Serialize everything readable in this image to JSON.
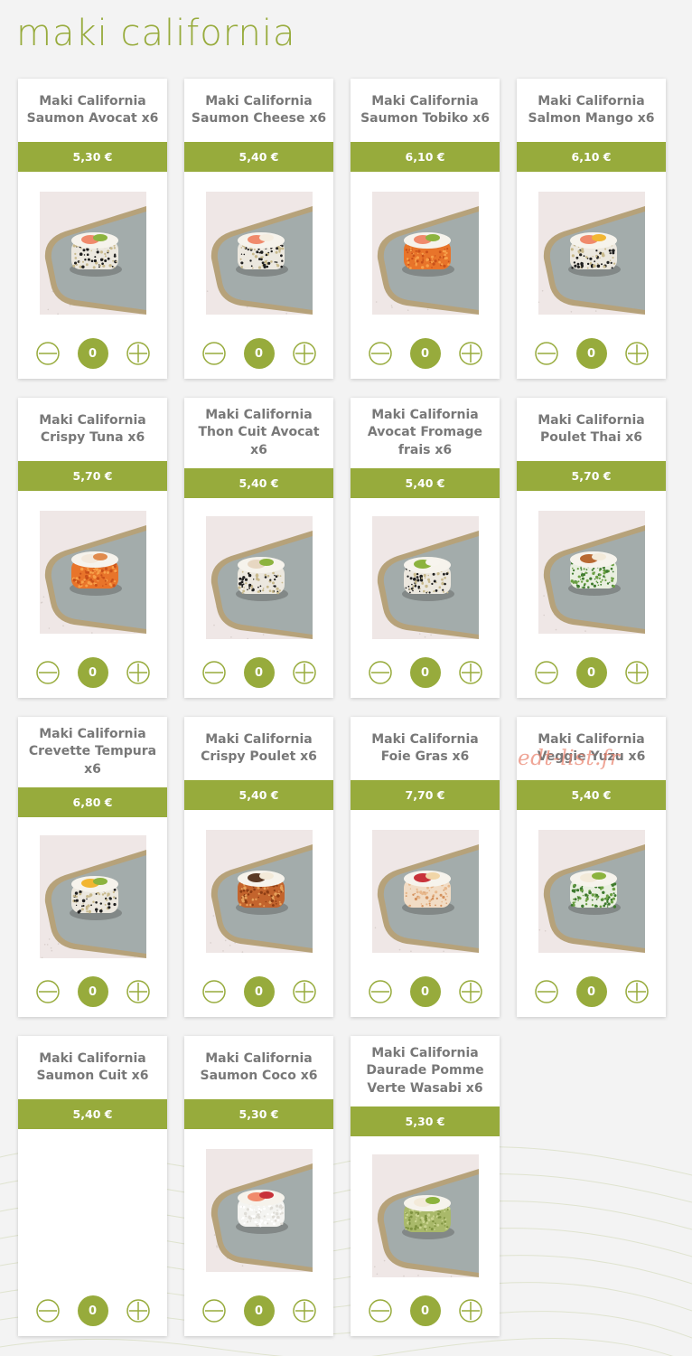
{
  "page": {
    "title": "maki california",
    "watermark": "edt-list.fr"
  },
  "colors": {
    "accent": "#97ab3c",
    "card_text": "#787878",
    "background": "#f3f3f3",
    "watermark": "#e9826e"
  },
  "icons": {
    "decrement": "minus-circle-icon",
    "increment": "plus-circle-icon"
  },
  "products": [
    {
      "name": "Maki California Saumon Avocat x6",
      "price": "5,30 €",
      "quantity": "0",
      "topping": "salmon-avocado",
      "coating": "sesame"
    },
    {
      "name": "Maki California Saumon Cheese x6",
      "price": "5,40 €",
      "quantity": "0",
      "topping": "salmon-cheese",
      "coating": "sesame"
    },
    {
      "name": "Maki California Saumon Tobiko x6",
      "price": "6,10 €",
      "quantity": "0",
      "topping": "salmon-avocado",
      "coating": "tobiko"
    },
    {
      "name": "Maki California Salmon Mango x6",
      "price": "6,10 €",
      "quantity": "0",
      "topping": "salmon-mango",
      "coating": "sesame"
    },
    {
      "name": "Maki California Crispy Tuna x6",
      "price": "5,70 €",
      "quantity": "0",
      "topping": "crispy-tuna",
      "coating": "tobiko"
    },
    {
      "name": "Maki California Thon Cuit Avocat x6",
      "price": "5,40 €",
      "quantity": "0",
      "topping": "tuna-avocado",
      "coating": "sesame"
    },
    {
      "name": "Maki California Avocat Fromage frais x6",
      "price": "5,40 €",
      "quantity": "0",
      "topping": "avocado-cheese",
      "coating": "sesame"
    },
    {
      "name": "Maki California Poulet Thai x6",
      "price": "5,70 €",
      "quantity": "0",
      "topping": "chicken",
      "coating": "herbs"
    },
    {
      "name": "Maki California Crevette Tempura x6",
      "price": "6,80 €",
      "quantity": "0",
      "topping": "shrimp-mango",
      "coating": "sesame"
    },
    {
      "name": "Maki California Crispy Poulet x6",
      "price": "5,40 €",
      "quantity": "0",
      "topping": "crispy-chicken",
      "coating": "crispy"
    },
    {
      "name": "Maki California Foie Gras x6",
      "price": "7,70 €",
      "quantity": "0",
      "topping": "foie-gras",
      "coating": "crispy-light"
    },
    {
      "name": "Maki California Veggie Yuzu x6",
      "price": "5,40 €",
      "quantity": "0",
      "topping": "veggie",
      "coating": "herbs"
    },
    {
      "name": "Maki California Saumon Cuit x6",
      "price": "5,40 €",
      "quantity": "0",
      "topping": "none",
      "coating": "none"
    },
    {
      "name": "Maki California Saumon Coco x6",
      "price": "5,30 €",
      "quantity": "0",
      "topping": "salmon-coco",
      "coating": "coconut"
    },
    {
      "name": "Maki California Daurade Pomme Verte Wasabi x6",
      "price": "5,30 €",
      "quantity": "0",
      "topping": "daurade",
      "coating": "green-crumb"
    }
  ]
}
